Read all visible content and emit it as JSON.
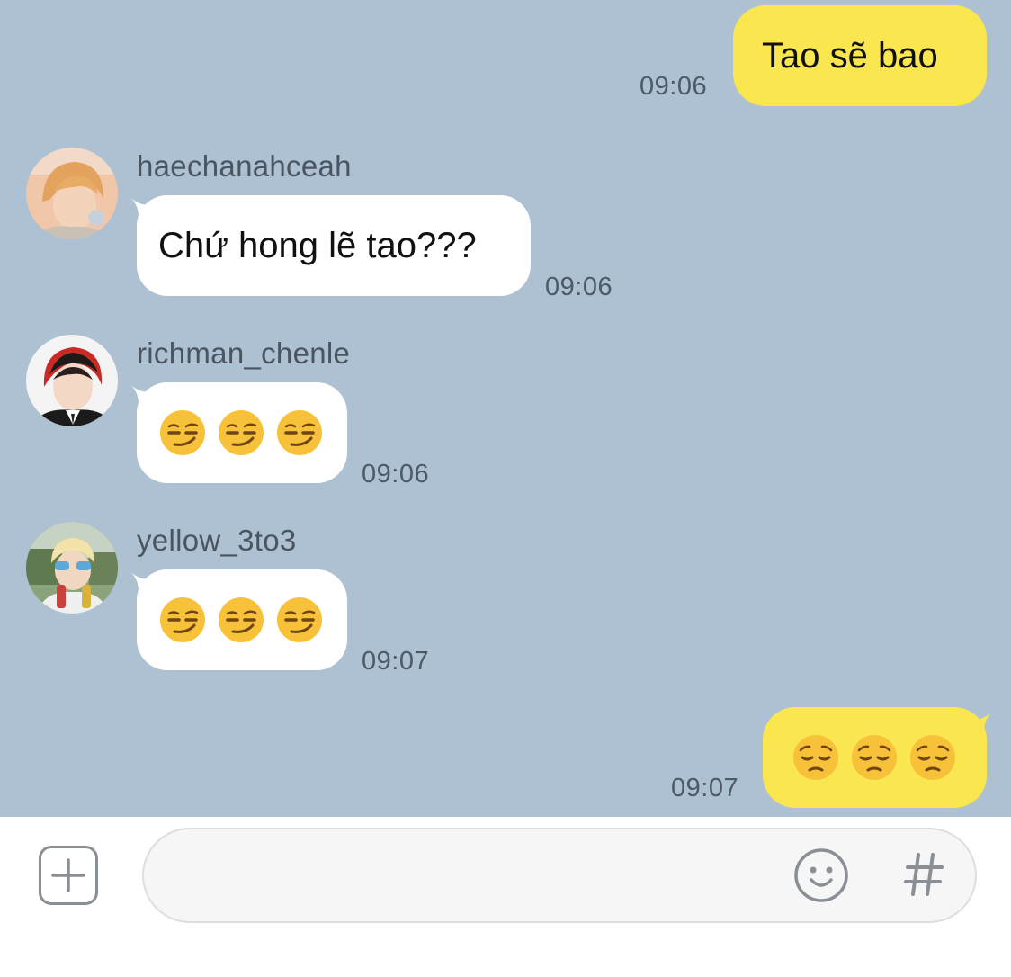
{
  "messages": [
    {
      "id": "m1",
      "sender": "me",
      "text": "Tao sẽ bao",
      "time": "09:06"
    },
    {
      "id": "m2",
      "sender": "haechanahceah",
      "text": "Chứ hong lẽ tao???",
      "time": "09:06"
    },
    {
      "id": "m3",
      "sender": "richman_chenle",
      "emojis": [
        "smirk",
        "smirk",
        "smirk"
      ],
      "time": "09:06"
    },
    {
      "id": "m4",
      "sender": "yellow_3to3",
      "emojis": [
        "smirk",
        "smirk",
        "smirk"
      ],
      "time": "09:07"
    },
    {
      "id": "m5",
      "sender": "me",
      "emojis": [
        "pensive",
        "pensive",
        "pensive"
      ],
      "time": "09:07"
    }
  ],
  "input": {
    "placeholder": "",
    "value": ""
  },
  "icons": {
    "attach": "plus-square-icon",
    "emoji": "smiley-icon",
    "hashtag": "hashtag-icon"
  },
  "colors": {
    "chat_background": "#aec1d2",
    "outgoing_bubble": "#fae64f",
    "incoming_bubble": "#ffffff"
  }
}
